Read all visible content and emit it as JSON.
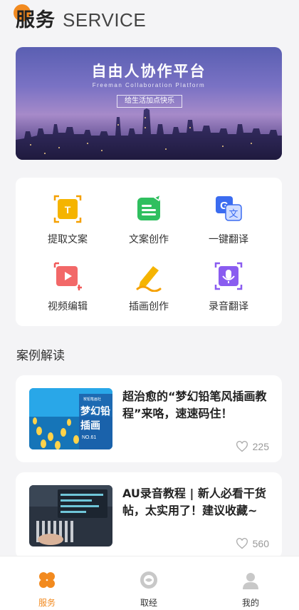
{
  "header": {
    "title_cn": "服务",
    "title_en": "SERVICE",
    "accent": "#f28a1f"
  },
  "banner": {
    "title": "自由人协作平台",
    "subtitle": "Freeman Collaboration Platform",
    "tag": "给生活加点快乐"
  },
  "services": [
    {
      "label": "提取文案",
      "icon": "text-extract-icon",
      "color": "#f5b400"
    },
    {
      "label": "文案创作",
      "icon": "copywriting-icon",
      "color": "#2fbf5f"
    },
    {
      "label": "一键翻译",
      "icon": "translate-icon",
      "color": "#3b6cf0"
    },
    {
      "label": "视频编辑",
      "icon": "video-edit-icon",
      "color": "#f25a5a"
    },
    {
      "label": "插画创作",
      "icon": "illustration-pen-icon",
      "color": "#f5b400"
    },
    {
      "label": "录音翻译",
      "icon": "voice-translate-icon",
      "color": "#8a5cf0"
    }
  ],
  "section": {
    "title": "案例解读"
  },
  "articles": [
    {
      "title": "超治愈的“梦幻铅笔风插画教程”来咯，速速码住！",
      "likes": "225",
      "thumb_line1": "梦幻铅",
      "thumb_line2": "插画",
      "thumb_no": "NO.61",
      "thumb_tag": "炭铅笔画社"
    },
    {
      "title": "AU录音教程 | 新人必看干货帖，太实用了！建议收藏~",
      "likes": "560"
    }
  ],
  "tabbar": {
    "items": [
      {
        "label": "服务",
        "icon": "clover-icon",
        "active": true
      },
      {
        "label": "取经",
        "icon": "compass-icon",
        "active": false
      },
      {
        "label": "我的",
        "icon": "user-avatar-icon",
        "active": false
      }
    ]
  }
}
